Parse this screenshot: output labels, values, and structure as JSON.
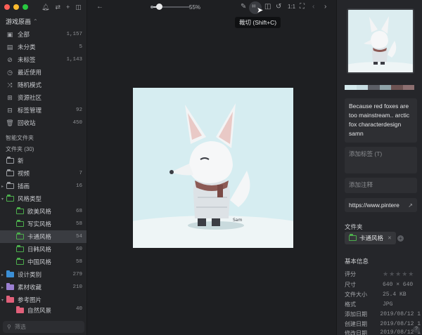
{
  "library": {
    "name": "游戏原画"
  },
  "nav": [
    {
      "label": "全部",
      "count": "1,157",
      "icon": "all-items-icon"
    },
    {
      "label": "未分类",
      "count": "5",
      "icon": "uncategorized-icon"
    },
    {
      "label": "未标签",
      "count": "1,143",
      "icon": "untagged-icon"
    },
    {
      "label": "最近使用",
      "count": "",
      "icon": "recent-icon"
    },
    {
      "label": "随机模式",
      "count": "",
      "icon": "shuffle-icon"
    },
    {
      "label": "资源社区",
      "count": "",
      "icon": "community-icon"
    },
    {
      "label": "标签管理",
      "count": "92",
      "icon": "tag-manager-icon"
    },
    {
      "label": "回收站",
      "count": "450",
      "icon": "trash-icon"
    }
  ],
  "smart_folders_label": "智能文件夹",
  "folders_label": "文件夹 (30)",
  "folders": [
    {
      "label": "新",
      "count": ""
    },
    {
      "label": "视频",
      "count": "7"
    },
    {
      "label": "插画",
      "count": "16"
    },
    {
      "label": "风格类型",
      "count": ""
    },
    {
      "label": "欧美风格",
      "count": "68"
    },
    {
      "label": "写实风格",
      "count": "58"
    },
    {
      "label": "卡通风格",
      "count": "54"
    },
    {
      "label": "日韩风格",
      "count": "60"
    },
    {
      "label": "中国风格",
      "count": "58"
    },
    {
      "label": "设计类别",
      "count": "279"
    },
    {
      "label": "素材收藏",
      "count": "210"
    },
    {
      "label": "参考图片",
      "count": ""
    },
    {
      "label": "自然风景",
      "count": "40"
    }
  ],
  "search_placeholder": "筛选",
  "toolbar": {
    "zoom": "55%",
    "zoom_fraction": 0.55,
    "ratio_label": "1:1",
    "tooltip": "裁切 (Shift+C)"
  },
  "inspector": {
    "note": "Because red foxes are too mainstream.. arctic fox characterdesign samn",
    "tags_placeholder": "添加标签 (T)",
    "annotation_placeholder": "添加注释",
    "url": "https://www.pintere",
    "folder_section": "文件夹",
    "folder_chip": "卡通风格",
    "basic_info": "基本信息",
    "info": [
      {
        "k": "评分",
        "v": ""
      },
      {
        "k": "尺寸",
        "v": "640 × 640"
      },
      {
        "k": "文件大小",
        "v": "25.4 KB"
      },
      {
        "k": "格式",
        "v": "JPG"
      },
      {
        "k": "添加日期",
        "v": "2019/08/12 1"
      },
      {
        "k": "创建日期",
        "v": "2019/08/12 1"
      },
      {
        "k": "修改日期",
        "v": "2019/08/12 1"
      }
    ],
    "palette": [
      "#d4eaee",
      "#c7dde2",
      "#5c5f66",
      "#8ea3a8",
      "#6d5352",
      "#8c6f70"
    ]
  },
  "colors": {
    "accent": "#4cae4c",
    "selected_row": "#3a3c41"
  }
}
